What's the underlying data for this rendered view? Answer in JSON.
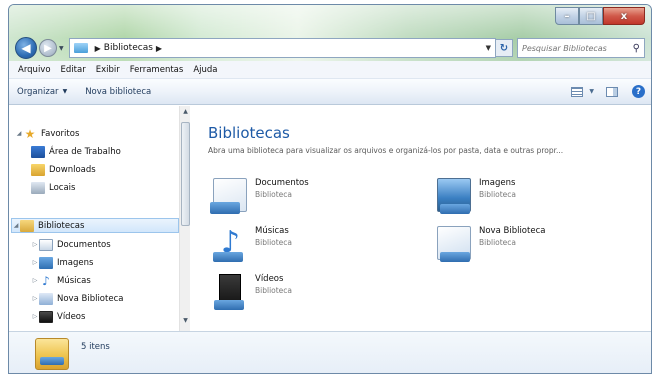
{
  "window": {
    "controls": {
      "minimize": "–",
      "maximize": "□",
      "close": "x"
    }
  },
  "address_bar": {
    "crumb": "Bibliotecas",
    "search_placeholder": "Pesquisar Bibliotecas"
  },
  "menu": [
    "Arquivo",
    "Editar",
    "Exibir",
    "Ferramentas",
    "Ajuda"
  ],
  "toolbar": {
    "organize_label": "Organizar",
    "new_library_label": "Nova biblioteca"
  },
  "navigation_pane": {
    "favorites": {
      "label": "Favoritos",
      "items": [
        "Área de Trabalho",
        "Downloads",
        "Locais"
      ]
    },
    "libraries": {
      "label": "Bibliotecas",
      "items": [
        "Documentos",
        "Imagens",
        "Músicas",
        "Nova Biblioteca",
        "Vídeos"
      ]
    }
  },
  "content": {
    "title": "Bibliotecas",
    "subtitle": "Abra uma biblioteca para visualizar os arquivos e organizá-los por pasta, data e outras propr...",
    "libraries": [
      {
        "name": "Documentos",
        "kind": "Biblioteca",
        "icon": "documents-library-icon"
      },
      {
        "name": "Imagens",
        "kind": "Biblioteca",
        "icon": "pictures-library-icon"
      },
      {
        "name": "Músicas",
        "kind": "Biblioteca",
        "icon": "music-library-icon"
      },
      {
        "name": "Nova Biblioteca",
        "kind": "Biblioteca",
        "icon": "new-library-icon"
      },
      {
        "name": "Vídeos",
        "kind": "Biblioteca",
        "icon": "videos-library-icon"
      }
    ]
  },
  "details_pane": {
    "count_text": "5 itens"
  },
  "colors": {
    "title_blue": "#1e5aa6",
    "accent": "#2a6fc9"
  }
}
